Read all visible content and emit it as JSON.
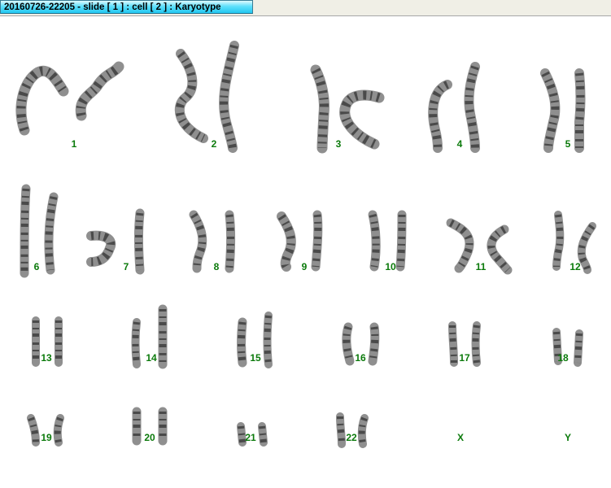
{
  "window": {
    "title": "20160726-22205 - slide [ 1 ] : cell [ 2 ] : Karyotype"
  },
  "karyotype": {
    "pairs": [
      {
        "label": "1"
      },
      {
        "label": "2"
      },
      {
        "label": "3"
      },
      {
        "label": "4"
      },
      {
        "label": "5"
      },
      {
        "label": "6"
      },
      {
        "label": "7"
      },
      {
        "label": "8"
      },
      {
        "label": "9"
      },
      {
        "label": "10"
      },
      {
        "label": "11"
      },
      {
        "label": "12"
      },
      {
        "label": "13"
      },
      {
        "label": "14"
      },
      {
        "label": "15"
      },
      {
        "label": "16"
      },
      {
        "label": "17"
      },
      {
        "label": "18"
      },
      {
        "label": "19"
      },
      {
        "label": "20"
      },
      {
        "label": "21"
      },
      {
        "label": "22"
      },
      {
        "label": "X"
      },
      {
        "label": "Y"
      }
    ]
  },
  "colors": {
    "label": "#0b7a0b",
    "title_tab": "#22c7f1",
    "chromosome": "#6a6a6a"
  }
}
